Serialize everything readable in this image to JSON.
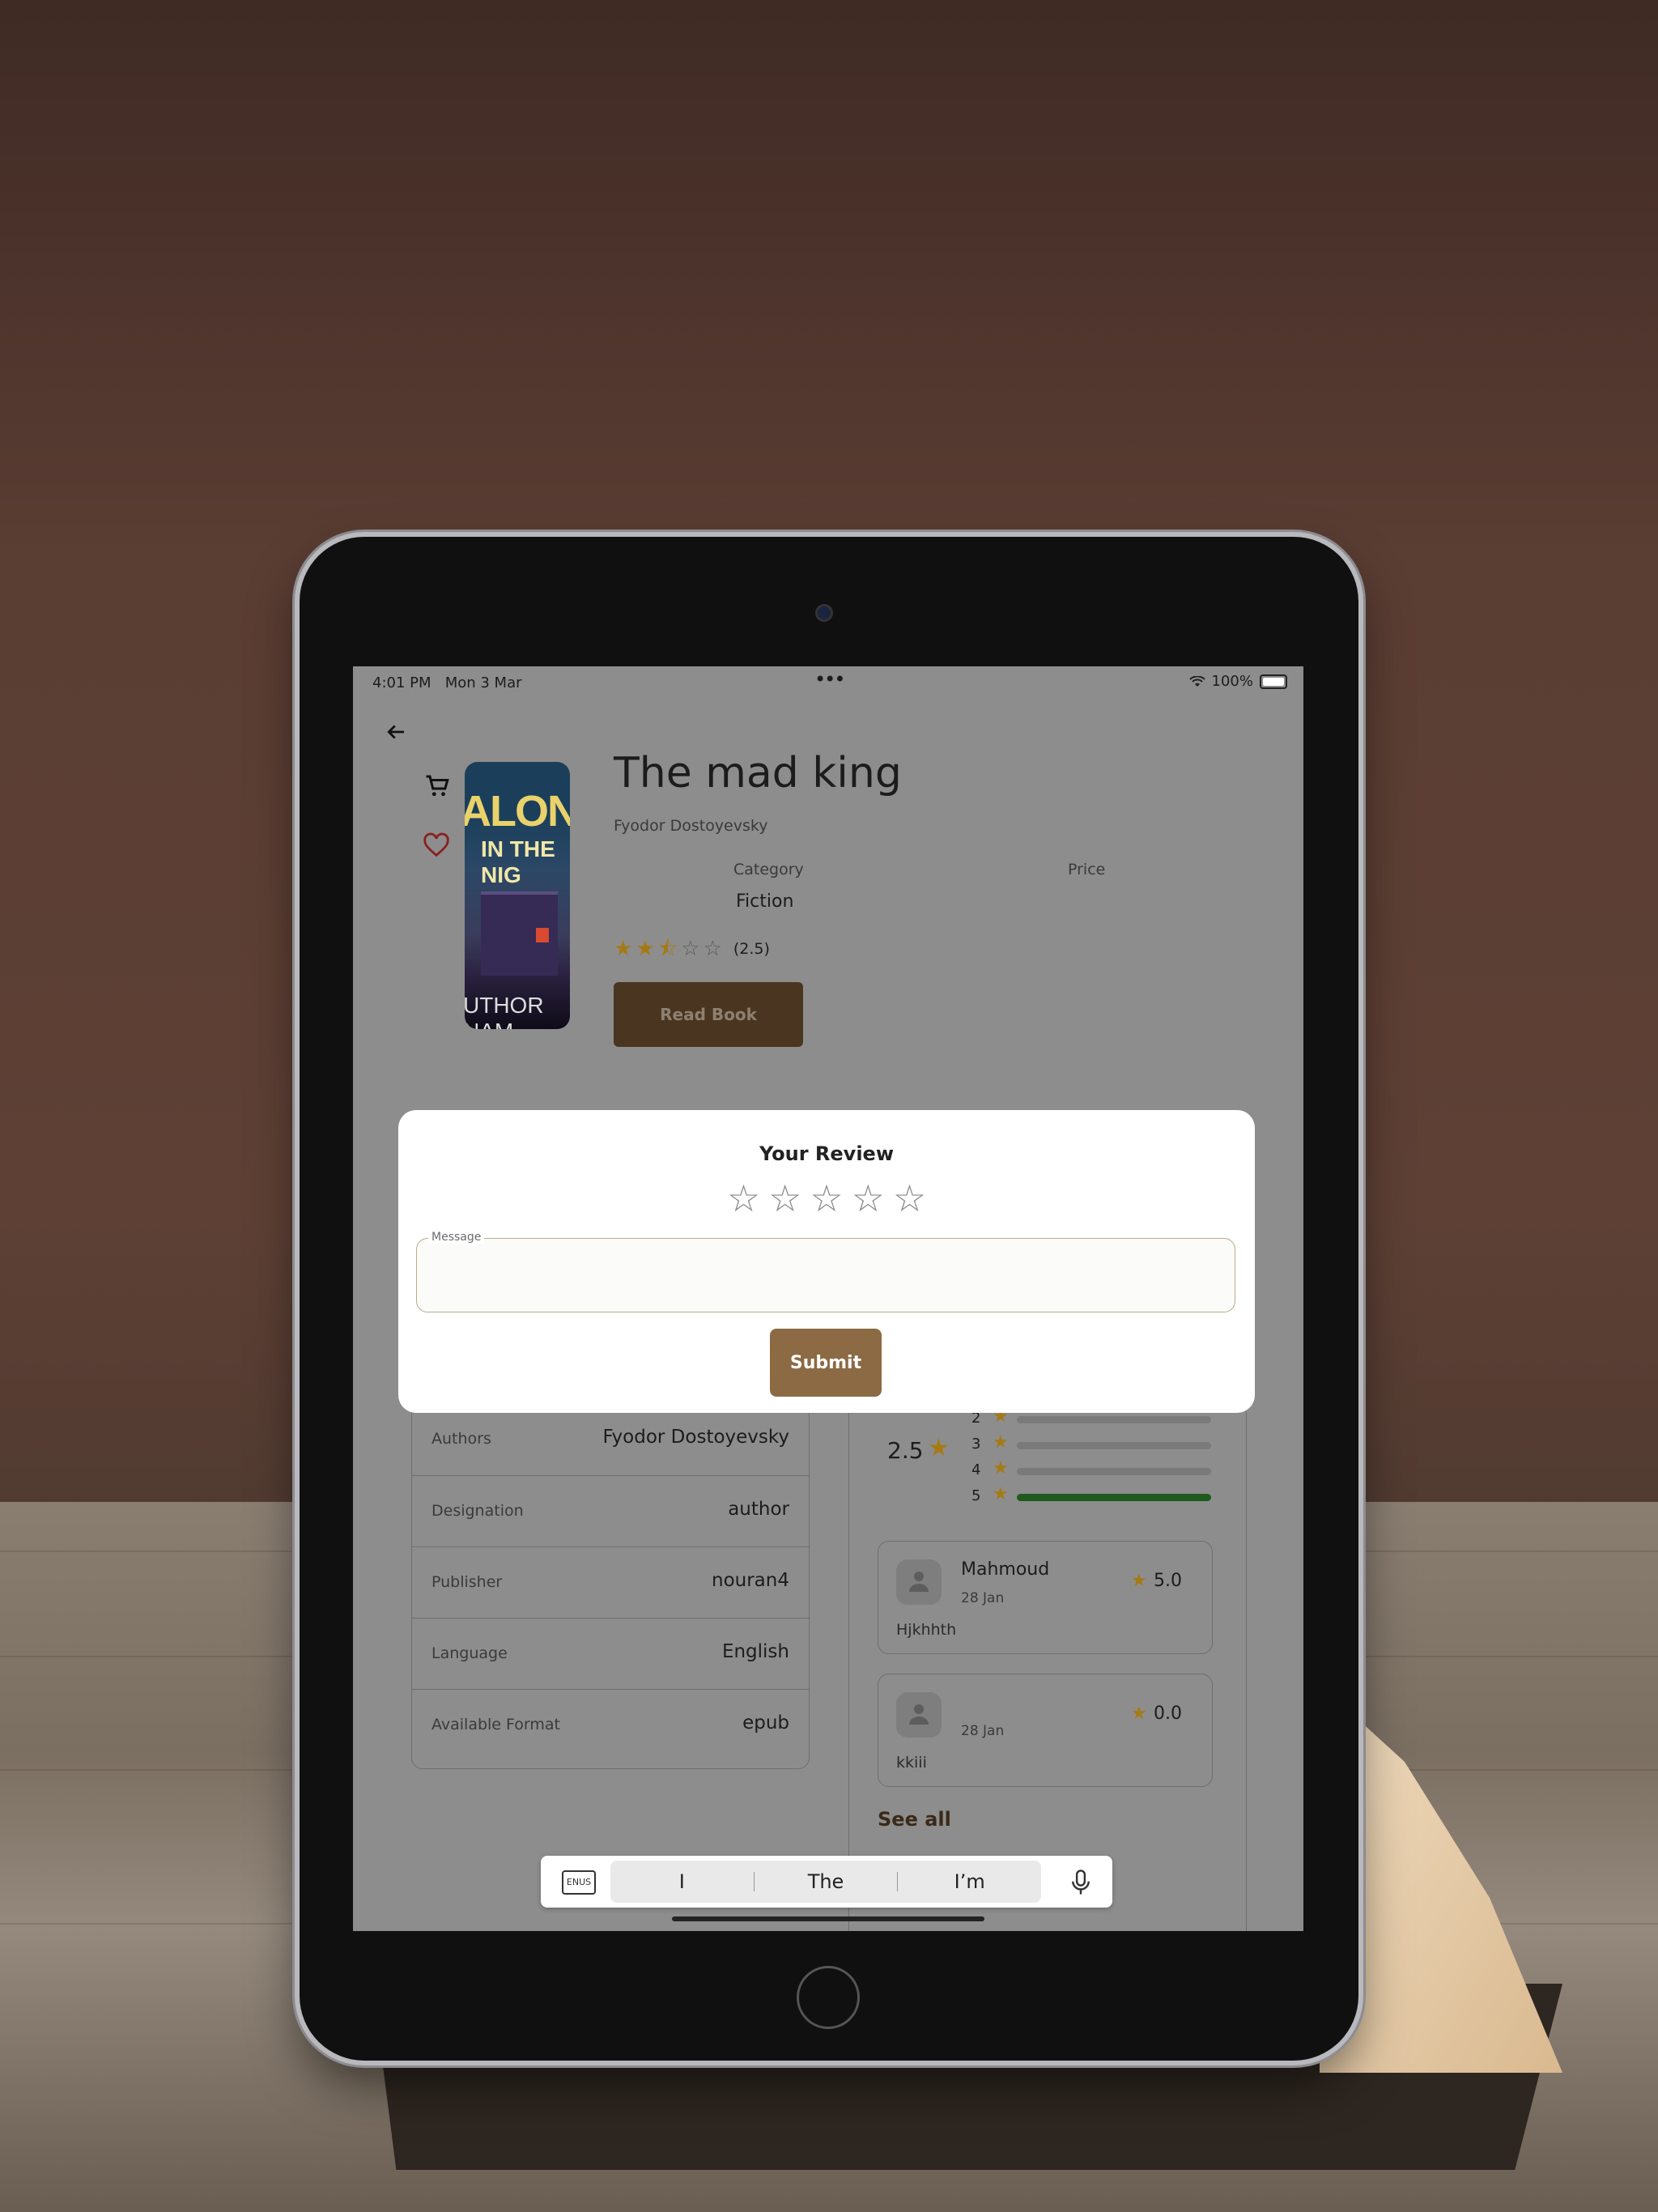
{
  "status_bar": {
    "time": "4:01 PM",
    "date": "Mon 3 Mar",
    "battery": "100%"
  },
  "book": {
    "title": "The mad king",
    "author": "Fyodor Dostoyevsky",
    "category_label": "Category",
    "category": "Fiction",
    "price_label": "Price",
    "rating": 2.5,
    "rating_text": "(2.5)",
    "read_button": "Read Book",
    "cover": {
      "line1": "ALON",
      "line2": "IN THE NIG",
      "author": "UTHOR NAM"
    }
  },
  "details": [
    {
      "label": "Authors",
      "value": "Fyodor Dostoyevsky"
    },
    {
      "label": "Designation",
      "value": "author"
    },
    {
      "label": "Publisher",
      "value": "nouran4"
    },
    {
      "label": "Language",
      "value": "English"
    },
    {
      "label": "Available Format",
      "value": "epub"
    }
  ],
  "reviews_summary": {
    "average": "2.5",
    "bars": [
      {
        "star": "2",
        "fraction": 0.0
      },
      {
        "star": "3",
        "fraction": 0.0
      },
      {
        "star": "4",
        "fraction": 0.0
      },
      {
        "star": "5",
        "fraction": 1.0
      }
    ]
  },
  "reviews": [
    {
      "name": "Mahmoud",
      "date": "28 Jan",
      "rating": "5.0",
      "text": "Hjkhhth"
    },
    {
      "name": "",
      "date": "28 Jan",
      "rating": "0.0",
      "text": "kkiii"
    }
  ],
  "see_all": "See all",
  "modal": {
    "title": "Your Review",
    "message_label": "Message",
    "message_value": "",
    "submit": "Submit",
    "stars_selected": 0
  },
  "keyboard": {
    "icon_label": "ENUS",
    "suggestions": [
      "I",
      "The",
      "I’m"
    ]
  },
  "colors": {
    "accent_brown": "#8b6a44",
    "star_gold": "#c8a020",
    "bar_green": "#2e7d32",
    "heart_red": "#c0392b"
  }
}
